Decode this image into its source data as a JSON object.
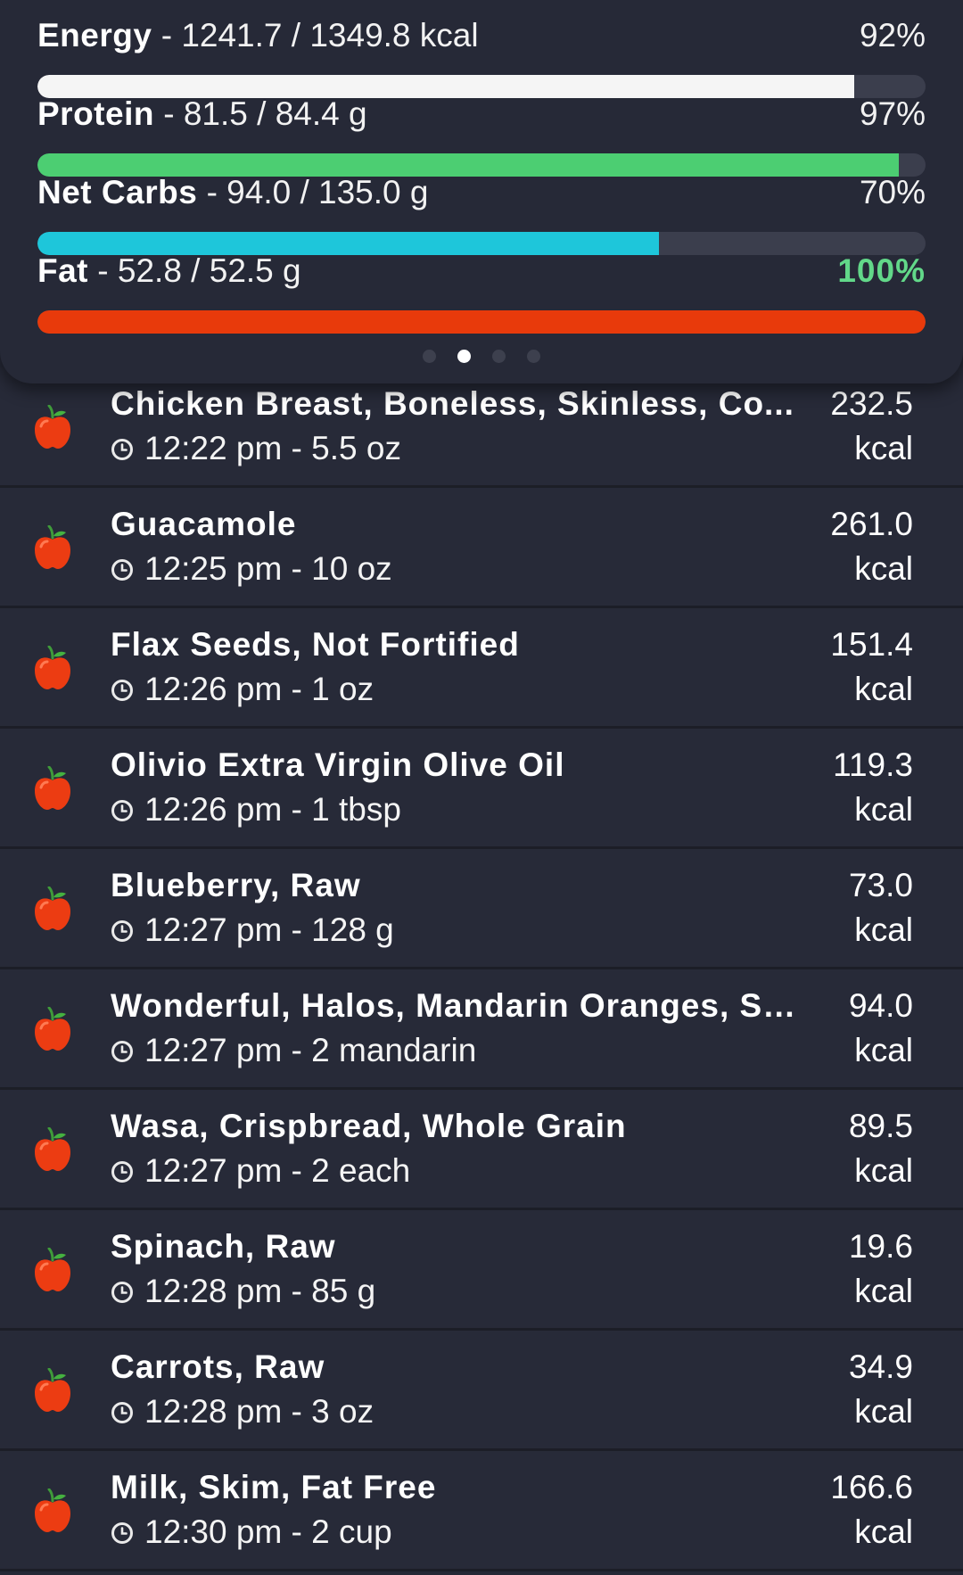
{
  "summary": {
    "macros": [
      {
        "name": "Energy",
        "values": "1241.7 / 1349.8 kcal",
        "percent_label": "92%",
        "fill": 0.92,
        "color": "#f5f5f5"
      },
      {
        "name": "Protein",
        "values": "81.5 / 84.4 g",
        "percent_label": "97%",
        "fill": 0.97,
        "color": "#4cce72"
      },
      {
        "name": "Net Carbs",
        "values": "94.0 / 135.0 g",
        "percent_label": "70%",
        "fill": 0.7,
        "color": "#1ec6da"
      },
      {
        "name": "Fat",
        "values": "52.8 / 52.5 g",
        "percent_label": "100%",
        "fill": 1.0,
        "color": "#e83a0b"
      }
    ],
    "separator": "-",
    "pager": {
      "count": 4,
      "active": 1
    }
  },
  "foods": [
    {
      "name": "Chicken Breast, Boneless, Skinless, Co...",
      "time": "12:22 pm",
      "amount": "5.5 oz",
      "kcal": "232.5",
      "unit": "kcal"
    },
    {
      "name": "Guacamole",
      "time": "12:25 pm",
      "amount": "10 oz",
      "kcal": "261.0",
      "unit": "kcal"
    },
    {
      "name": "Flax Seeds, Not Fortified",
      "time": "12:26 pm",
      "amount": "1 oz",
      "kcal": "151.4",
      "unit": "kcal"
    },
    {
      "name": "Olivio Extra Virgin Olive Oil",
      "time": "12:26 pm",
      "amount": "1 tbsp",
      "kcal": "119.3",
      "unit": "kcal"
    },
    {
      "name": "Blueberry, Raw",
      "time": "12:27 pm",
      "amount": "128 g",
      "kcal": "73.0",
      "unit": "kcal"
    },
    {
      "name": "Wonderful, Halos, Mandarin Oranges, Se...",
      "time": "12:27 pm",
      "amount": "2 mandarin",
      "kcal": "94.0",
      "unit": "kcal"
    },
    {
      "name": "Wasa, Crispbread, Whole Grain",
      "time": "12:27 pm",
      "amount": "2 each",
      "kcal": "89.5",
      "unit": "kcal"
    },
    {
      "name": "Spinach, Raw",
      "time": "12:28 pm",
      "amount": "85 g",
      "kcal": "19.6",
      "unit": "kcal"
    },
    {
      "name": "Carrots, Raw",
      "time": "12:28 pm",
      "amount": "3 oz",
      "kcal": "34.9",
      "unit": "kcal"
    },
    {
      "name": "Milk, Skim, Fat Free",
      "time": "12:30 pm",
      "amount": "2 cup",
      "kcal": "166.6",
      "unit": "kcal"
    }
  ],
  "icons": {
    "food": "apple-icon",
    "time": "clock-icon"
  }
}
